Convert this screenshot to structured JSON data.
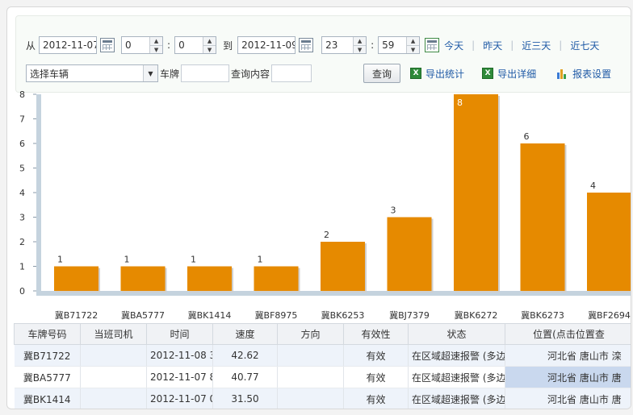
{
  "filter": {
    "from_label": "从",
    "from_date": "2012-11-07",
    "from_hour": "0",
    "from_min": "0",
    "to_label": "到",
    "to_date": "2012-11-09",
    "to_hour": "23",
    "to_min": "59",
    "colon": ":",
    "quick": [
      "今天",
      "昨天",
      "近三天",
      "近七天"
    ],
    "vehicle_select": "选择车辆",
    "plate_label": "车牌",
    "plate_value": "",
    "query_label": "查询内容",
    "query_value": "",
    "query_button": "查询",
    "export_stats": "导出统计",
    "export_detail": "导出详细",
    "report_settings": "报表设置"
  },
  "colors": {
    "bar": "#e68a00",
    "axis": "#c5d3de",
    "link": "#1f5aa6"
  },
  "chart_data": {
    "type": "bar",
    "categories": [
      "冀B71722",
      "冀BA5777",
      "冀BK1414",
      "冀BF8975",
      "冀BK6253",
      "冀BJ7379",
      "冀BK6272",
      "冀BK6273",
      "冀BF2694"
    ],
    "values": [
      1,
      1,
      1,
      1,
      2,
      3,
      8,
      6,
      4
    ],
    "title": "",
    "xlabel": "",
    "ylabel": "",
    "ylim": [
      0,
      8
    ],
    "yticks": [
      0,
      1,
      2,
      3,
      4,
      5,
      6,
      7,
      8
    ],
    "grid": false,
    "data_labels": true
  },
  "table": {
    "headers": [
      "车牌号码",
      "当班司机",
      "时间",
      "速度",
      "方向",
      "有效性",
      "状态",
      "位置(点击位置查"
    ],
    "rows": [
      [
        "冀B71722",
        "",
        "2012-11-08 3",
        "42.62",
        "",
        "有效",
        "在区域超速报警 (多边",
        "河北省 唐山市 滦"
      ],
      [
        "冀BA5777",
        "",
        "2012-11-07 8",
        "40.77",
        "",
        "有效",
        "在区域超速报警 (多边",
        "河北省 唐山市 唐"
      ],
      [
        "冀BK1414",
        "",
        "2012-11-07 0",
        "31.50",
        "",
        "有效",
        "在区域超速报警 (多边",
        "河北省 唐山市 唐"
      ]
    ]
  }
}
